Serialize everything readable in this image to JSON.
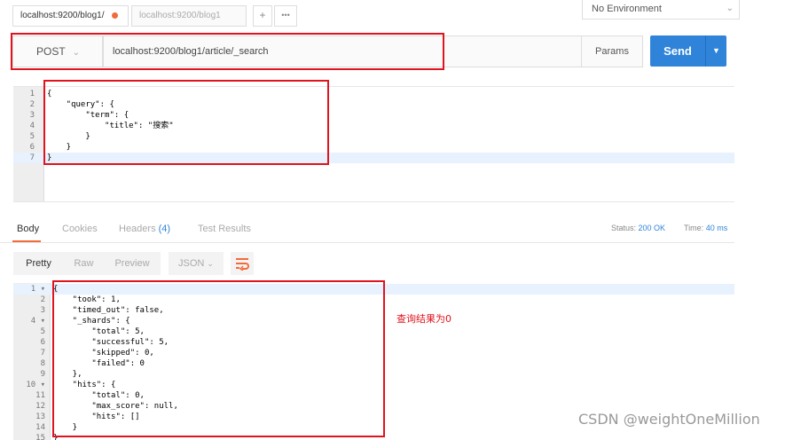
{
  "tabs": [
    {
      "label": "localhost:9200/blog1/",
      "active": true,
      "unsaved": true
    },
    {
      "label": "localhost:9200/blog1",
      "active": false
    }
  ],
  "tab_actions": {
    "add": "+",
    "more": "•••"
  },
  "environment": {
    "selected": "No Environment"
  },
  "request": {
    "method": "POST",
    "url": "localhost:9200/blog1/article/_search",
    "params_label": "Params",
    "send_label": "Send"
  },
  "request_body": {
    "lines": [
      {
        "n": "1",
        "text": "{"
      },
      {
        "n": "2",
        "text": "    \"query\": {"
      },
      {
        "n": "3",
        "text": "        \"term\": {"
      },
      {
        "n": "4",
        "text": "            \"title\": \"搜索\""
      },
      {
        "n": "5",
        "text": "        }"
      },
      {
        "n": "6",
        "text": "    }"
      },
      {
        "n": "7",
        "text": "}"
      }
    ]
  },
  "response_tabs": {
    "body": "Body",
    "cookies": "Cookies",
    "headers": "Headers",
    "headers_count": "(4)",
    "test_results": "Test Results"
  },
  "status": {
    "label": "Status:",
    "value": "200 OK"
  },
  "time": {
    "label": "Time:",
    "value": "40 ms"
  },
  "view_modes": {
    "pretty": "Pretty",
    "raw": "Raw",
    "preview": "Preview",
    "format": "JSON"
  },
  "response_body": {
    "lines": [
      {
        "n": "1 ▾",
        "text": "{"
      },
      {
        "n": "2",
        "text": "    \"took\": 1,"
      },
      {
        "n": "3",
        "text": "    \"timed_out\": false,"
      },
      {
        "n": "4 ▾",
        "text": "    \"_shards\": {"
      },
      {
        "n": "5",
        "text": "        \"total\": 5,"
      },
      {
        "n": "6",
        "text": "        \"successful\": 5,"
      },
      {
        "n": "7",
        "text": "        \"skipped\": 0,"
      },
      {
        "n": "8",
        "text": "        \"failed\": 0"
      },
      {
        "n": "9",
        "text": "    },"
      },
      {
        "n": "10 ▾",
        "text": "    \"hits\": {"
      },
      {
        "n": "11",
        "text": "        \"total\": 0,"
      },
      {
        "n": "12",
        "text": "        \"max_score\": null,"
      },
      {
        "n": "13",
        "text": "        \"hits\": []"
      },
      {
        "n": "14",
        "text": "    }"
      },
      {
        "n": "15",
        "text": "}"
      }
    ]
  },
  "annotation": "查询结果为0",
  "watermark": "CSDN @weightOneMillion",
  "colors": {
    "accent": "#f26b3a",
    "send": "#2f84d9",
    "highlight": "#e0141e"
  }
}
